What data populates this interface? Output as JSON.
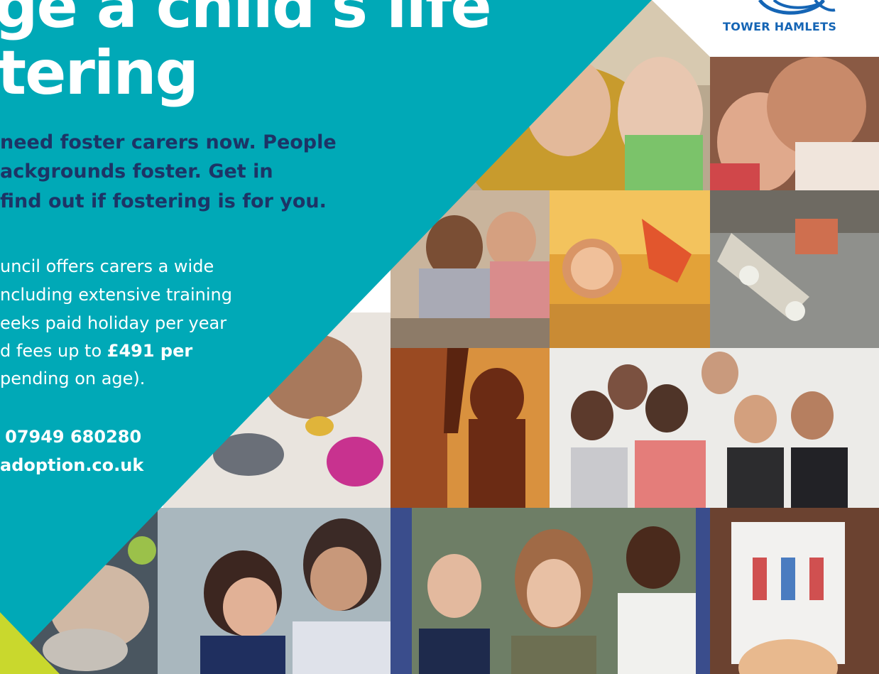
{
  "headline": {
    "line1": "ge a child's life",
    "line2": "tering"
  },
  "lead_lines": [
    "need foster carers now. People",
    "ackgrounds foster. Get in",
    "find out if fostering is for you."
  ],
  "body_lines": [
    "uncil offers carers a wide",
    "ncluding extensive training",
    "eeks paid holiday per year",
    "d fees up to ",
    "pending on age)."
  ],
  "body_bold": "£491 per",
  "contact": {
    "phone": "/ 07949 680280",
    "website": "adoption.co.uk"
  },
  "logo": {
    "name": "TOWER HAMLETS",
    "icon": "council-swoosh-logo"
  },
  "colors": {
    "teal": "#00a9b7",
    "navy": "#1d3466",
    "logo_blue": "#1565b5",
    "accent_green": "#c9d82d"
  },
  "photos": [
    "hijab-woman-and-child",
    "parent-cuddling-child",
    "children-baking",
    "football-kick-sunset",
    "skateboard",
    "paint-covered-hand",
    "silhouette-holding-hands",
    "group-of-foster-carers",
    "baking-flour-hands",
    "woman-hugging-girl",
    "woman-with-two-boys",
    "child-drawing-family"
  ]
}
